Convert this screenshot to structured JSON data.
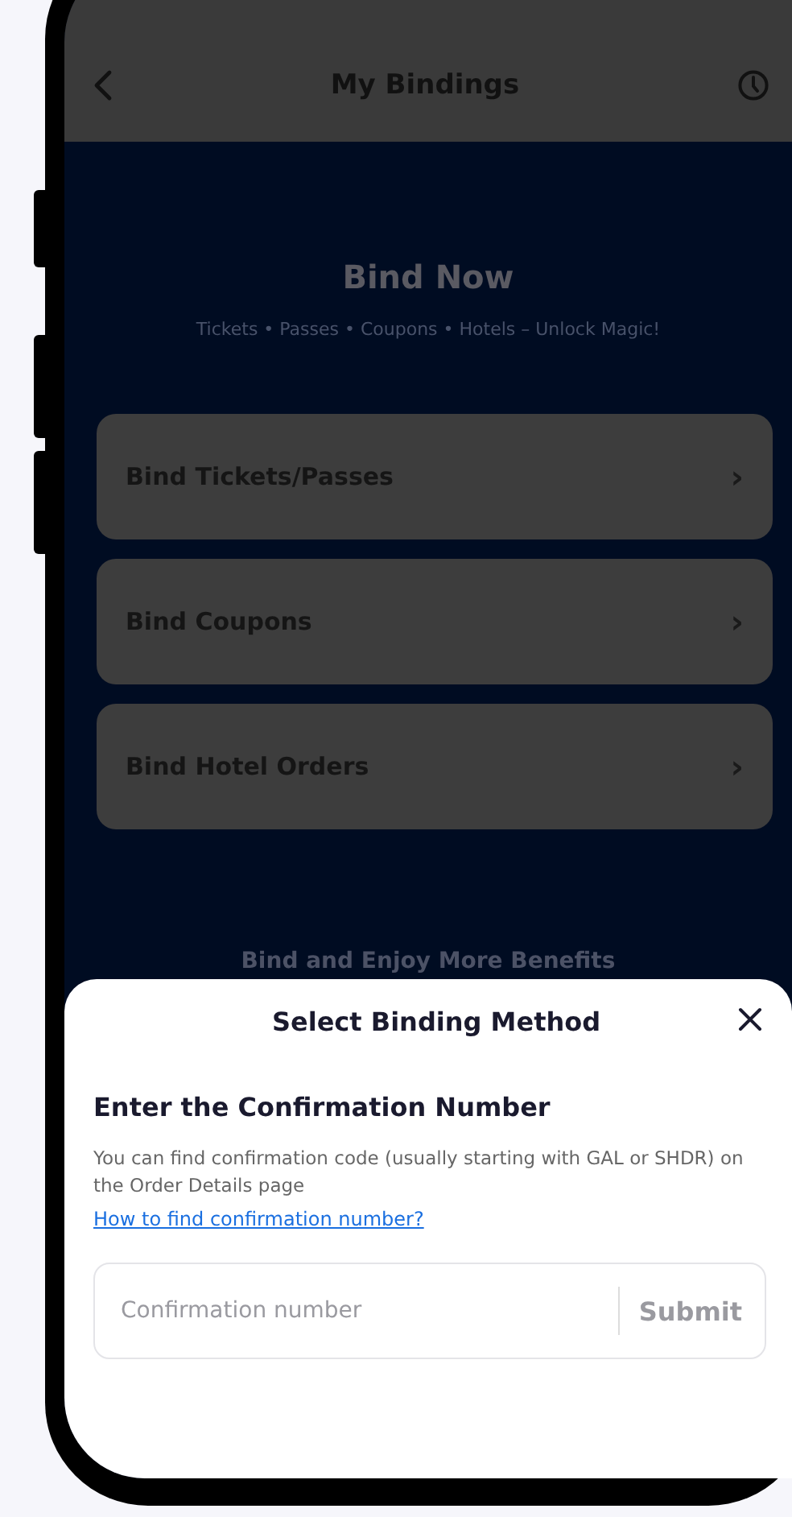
{
  "header": {
    "title": "My Bindings"
  },
  "hero": {
    "title": "Bind Now",
    "subtitle": "Tickets • Passes • Coupons • Hotels – Unlock Magic!"
  },
  "options": [
    {
      "label": "Bind Tickets/Passes",
      "chevron": "›"
    },
    {
      "label": "Bind Coupons",
      "chevron": "›"
    },
    {
      "label": "Bind Hotel Orders",
      "chevron": "›"
    }
  ],
  "benefits_heading": "Bind and Enjoy More Benefits",
  "sheet": {
    "title": "Select Binding Method",
    "heading": "Enter the Confirmation Number",
    "description": "You can find confirmation code (usually starting with GAL or SHDR) on the Order Details page",
    "help_link": "How to find confirmation number?",
    "field": {
      "placeholder": "Confirmation number"
    },
    "submit": "Submit"
  }
}
